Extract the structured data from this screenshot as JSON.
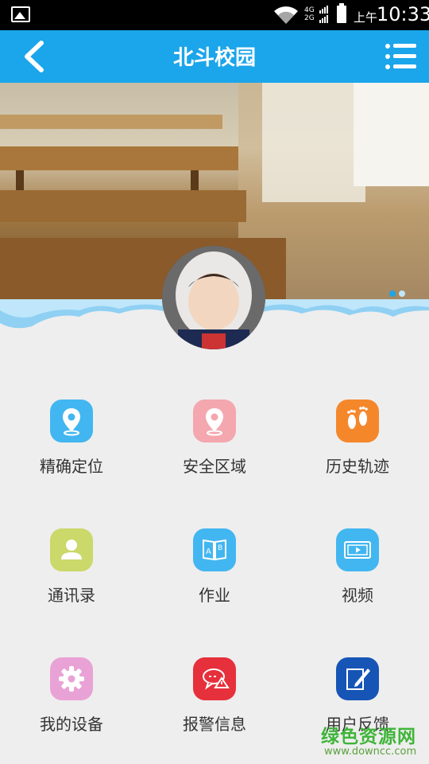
{
  "status_bar": {
    "network": "4G\n2G",
    "ampm": "上午",
    "time": "10:33"
  },
  "header": {
    "title": "北斗校园"
  },
  "banner": {
    "active_dot": 1,
    "dot_count": 2
  },
  "menu": [
    {
      "label": "精确定位",
      "icon": "location-pin-icon",
      "color": "#42b6f0"
    },
    {
      "label": "安全区域",
      "icon": "safe-zone-pin-icon",
      "color": "#f4a7ae"
    },
    {
      "label": "历史轨迹",
      "icon": "footprints-icon",
      "color": "#f5872b"
    },
    {
      "label": "通讯录",
      "icon": "contact-person-icon",
      "color": "#cbd86a"
    },
    {
      "label": "作业",
      "icon": "book-ab-icon",
      "color": "#42b6f0"
    },
    {
      "label": "视频",
      "icon": "video-film-icon",
      "color": "#42b6f0"
    },
    {
      "label": "我的设备",
      "icon": "gear-icon",
      "color": "#e9a2d6"
    },
    {
      "label": "报警信息",
      "icon": "alert-message-icon",
      "color": "#e6303c"
    },
    {
      "label": "用户反馈",
      "icon": "feedback-edit-icon",
      "color": "#1655b6"
    }
  ],
  "watermark": {
    "title": "绿色资源网",
    "url": "www.downcc.com"
  }
}
